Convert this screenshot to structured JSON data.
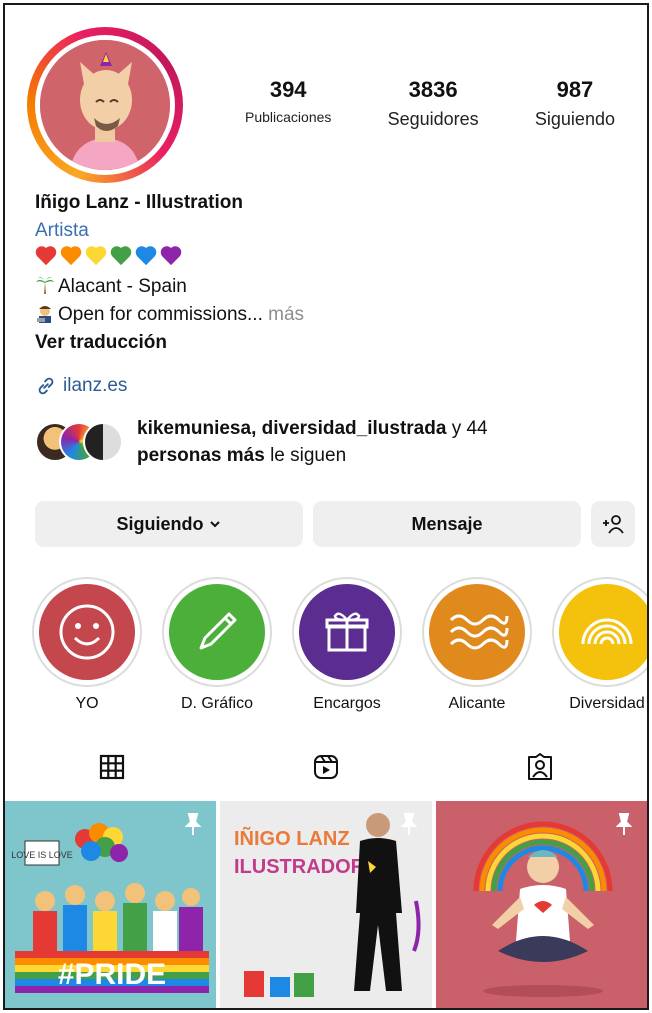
{
  "profile": {
    "stats": [
      {
        "value": "394",
        "label": "Publicaciones"
      },
      {
        "value": "3836",
        "label": "Seguidores"
      },
      {
        "value": "987",
        "label": "Siguiendo"
      }
    ],
    "name": "Iñigo Lanz - Illustration",
    "category": "Artista",
    "hearts": [
      "#e53935",
      "#fb8c00",
      "#fdd835",
      "#43a047",
      "#1e88e5",
      "#8e24aa"
    ],
    "location": "Alacant - Spain",
    "bio_line": "Open for commissions",
    "bio_ellipsis": "...",
    "more": "más",
    "translate": "Ver traducción",
    "link": "ilanz.es"
  },
  "followed_by": {
    "names": "kikemuniesa, diversidad_ilustrada",
    "conj": " y 44",
    "others": "personas más",
    "suffix": " le siguen"
  },
  "buttons": {
    "following": "Siguiendo",
    "message": "Mensaje"
  },
  "highlights": [
    {
      "label": "YO",
      "color": "#c4474e",
      "icon": "smile-icon"
    },
    {
      "label": "D. Gráfico",
      "color": "#4caf3a",
      "icon": "pencil-icon"
    },
    {
      "label": "Encargos",
      "color": "#5b2d91",
      "icon": "gift-icon"
    },
    {
      "label": "Alicante",
      "color": "#e08a1e",
      "icon": "waves-icon"
    },
    {
      "label": "Diversidad",
      "color": "#f4c20d",
      "icon": "rainbow-icon"
    }
  ],
  "grid": {
    "post1_text": "#PRIDE",
    "post1_sign": "LOVE IS LOVE",
    "post2_title_1": "IÑIGO LANZ",
    "post2_title_2": "ILUSTRADOR"
  }
}
